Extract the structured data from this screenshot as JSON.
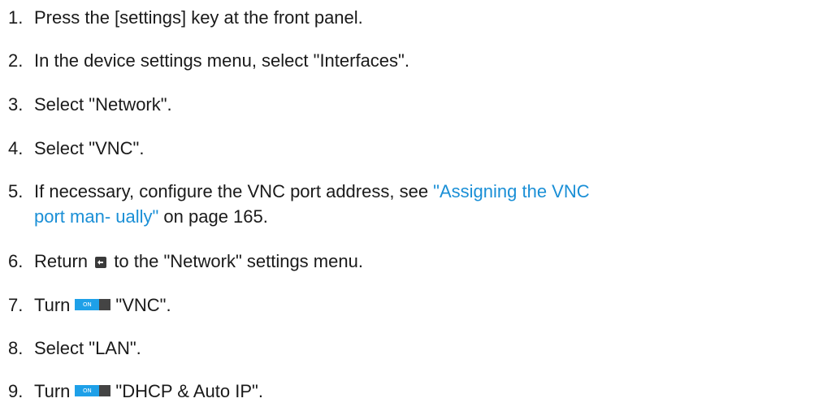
{
  "steps": [
    {
      "num": "1.",
      "text": "Press the [settings] key at the front panel."
    },
    {
      "num": "2.",
      "text": "In the device settings menu, select \"Interfaces\"."
    },
    {
      "num": "3.",
      "text": "Select \"Network\"."
    },
    {
      "num": "4.",
      "text": "Select \"VNC\"."
    },
    {
      "num": "5.",
      "before": "If necessary, configure the VNC port address, see ",
      "link": "\"Assigning the VNC port man- ually\"",
      "after": " on page 165."
    },
    {
      "num": "6.",
      "before": "Return",
      "after": "to the \"Network\" settings menu."
    },
    {
      "num": "7.",
      "before": "Turn",
      "toggle_label": "ON",
      "after": "\"VNC\"."
    },
    {
      "num": "8.",
      "text": "Select \"LAN\"."
    },
    {
      "num": "9.",
      "before": "Turn",
      "toggle_label": "ON",
      "after": "\"DHCP & Auto IP\"."
    }
  ],
  "icons": {
    "back_key": "back-arrow-key-icon",
    "toggle": "on-off-toggle-icon"
  },
  "colors": {
    "link": "#1a8fd6",
    "toggle_on": "#1ea0e8",
    "toggle_off": "#444444",
    "text": "#1a1a1a"
  }
}
